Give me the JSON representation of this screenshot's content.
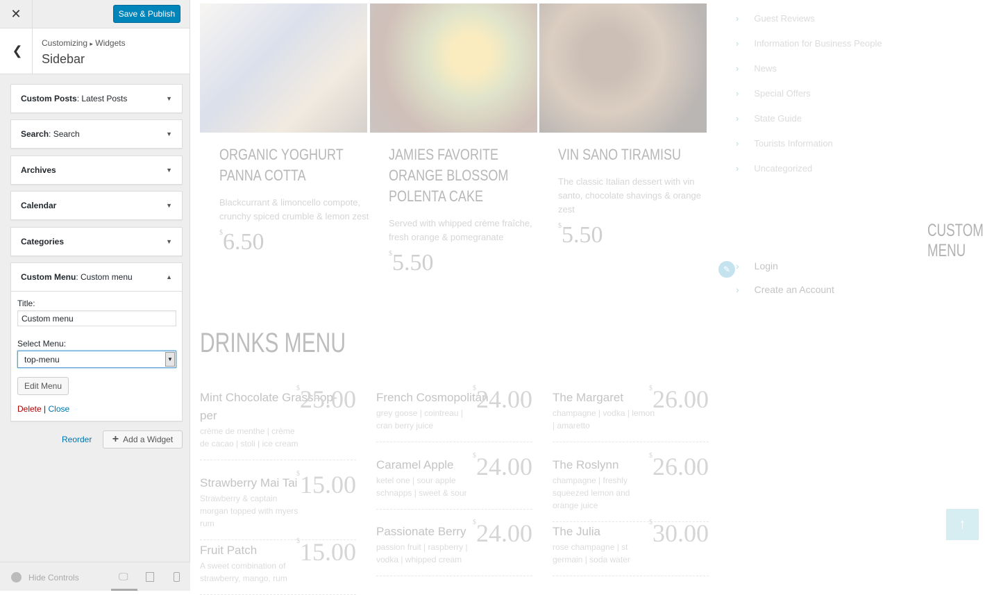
{
  "customizer": {
    "close": "✕",
    "publish": "Save & Publish",
    "breadcrumb_root": "Customizing",
    "breadcrumb_sep": "▸",
    "breadcrumb_section": "Widgets",
    "title": "Sidebar",
    "widgets": [
      {
        "type": "Custom Posts",
        "name": ": Latest Posts"
      },
      {
        "type": "Search",
        "name": ": Search"
      },
      {
        "type": "Archives",
        "name": ""
      },
      {
        "type": "Calendar",
        "name": ""
      },
      {
        "type": "Categories",
        "name": ""
      },
      {
        "type": "Custom Menu",
        "name": ": Custom menu"
      }
    ],
    "form": {
      "title_label": "Title:",
      "title_value": "Custom menu",
      "menu_label": "Select Menu:",
      "menu_value": "top-menu",
      "edit_menu": "Edit Menu",
      "delete": "Delete",
      "sep": "|",
      "close": "Close"
    },
    "reorder": "Reorder",
    "add_widget": "Add a Widget",
    "hide_controls": "Hide Controls"
  },
  "preview": {
    "dishes": [
      {
        "name": "Organic Yoghurt Panna Cotta",
        "desc": "Blackcurrant & limoncello compote, crunchy spiced crumble & lemon zest",
        "currency": "$",
        "price": "6.50"
      },
      {
        "name": "Jamies Favorite Orange Blossom Polenta Cake",
        "desc": "Served with whipped crème fraîche, fresh orange & pomegranate",
        "currency": "$",
        "price": "5.50"
      },
      {
        "name": "Vin Sano Tiramisu",
        "desc": "The classic Italian dessert with vin santo, chocolate shavings & orange zest",
        "currency": "$",
        "price": "5.50"
      }
    ],
    "drinks_title": "DRINKS MENU",
    "drinks": [
      {
        "name": "Mint Chocolate Grasshop-per",
        "desc": "crème de menthe | crème de cacao | stoli | ice cream",
        "price": "25.00"
      },
      {
        "name": "Strawberry Mai Tai",
        "desc": "Strawberry & captain morgan topped with myers rum",
        "price": "15.00"
      },
      {
        "name": "Fruit Patch",
        "desc": "A sweet combination of strawberry, mango, rum",
        "price": "15.00"
      },
      {
        "name": "French Cosmopolitan",
        "desc": "grey goose | cointreau | cran berry juice",
        "price": "24.00"
      },
      {
        "name": "Caramel Apple",
        "desc": "ketel one | sour apple schnapps | sweet & sour",
        "price": "24.00"
      },
      {
        "name": "Passionate Berry",
        "desc": "passion fruit | raspberry | vodka | whipped cream",
        "price": "24.00"
      },
      {
        "name": "The Margaret",
        "desc": "champagne | vodka | lemon | amaretto",
        "price": "26.00"
      },
      {
        "name": "The Roslynn",
        "desc": "champagne | freshly squeezed lemon and orange juice",
        "price": "26.00"
      },
      {
        "name": "The Julia",
        "desc": "rose champagne | st germain | soda water",
        "price": "30.00"
      }
    ],
    "categories": [
      "Guest Reviews",
      "Information for Business People",
      "News",
      "Special Offers",
      "State Guide",
      "Tourists Information",
      "Uncategorized"
    ],
    "custom_menu_title": "CUSTOM MENU",
    "custom_menu": [
      "Login",
      "Create an Account"
    ],
    "chevron": "›"
  }
}
